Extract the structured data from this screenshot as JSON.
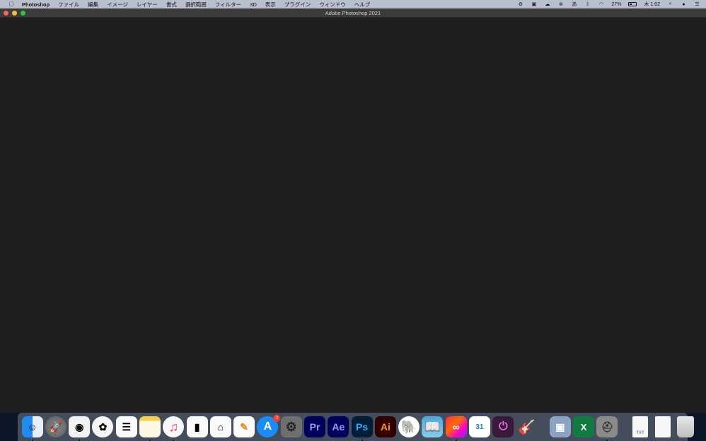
{
  "menubar": {
    "app_name": "Photoshop",
    "menus": [
      "ファイル",
      "編集",
      "イメージ",
      "レイヤー",
      "書式",
      "選択範囲",
      "フィルター",
      "3D",
      "表示",
      "プラグイン",
      "ウィンドウ",
      "ヘルプ"
    ],
    "status": {
      "battery_percent": "27%",
      "battery_level": 0.27,
      "clock": "木 1:02",
      "input_method": "あ"
    }
  },
  "window": {
    "title": "Adobe Photoshop 2021"
  },
  "dock": {
    "apps": [
      {
        "name": "Finder",
        "icon": "finder-icon",
        "glyph": "☺",
        "running": true
      },
      {
        "name": "Launchpad",
        "icon": "launchpad-icon",
        "glyph": "🚀",
        "running": false
      },
      {
        "name": "Google Chrome",
        "icon": "chrome-icon",
        "glyph": "◉",
        "running": true
      },
      {
        "name": "Photos",
        "icon": "photos-icon",
        "glyph": "✿",
        "running": false
      },
      {
        "name": "Reminders",
        "icon": "reminders-icon",
        "glyph": "☰",
        "running": false
      },
      {
        "name": "Notes",
        "icon": "notes-icon",
        "glyph": "",
        "running": true
      },
      {
        "name": "Music",
        "icon": "music-icon",
        "glyph": "♫",
        "running": true
      },
      {
        "name": "Numbers",
        "icon": "numbers-icon",
        "glyph": "▮",
        "running": false
      },
      {
        "name": "Keynote",
        "icon": "keynote-icon",
        "glyph": "⌂",
        "running": false
      },
      {
        "name": "Pages",
        "icon": "pages-icon",
        "glyph": "✎",
        "running": false
      },
      {
        "name": "App Store",
        "icon": "app-store-icon",
        "glyph": "A",
        "running": false,
        "badge": "2"
      },
      {
        "name": "System Preferences",
        "icon": "system-preferences-icon",
        "glyph": "⚙",
        "running": false
      },
      {
        "name": "Adobe Premiere Pro",
        "icon": "premiere-pro-icon",
        "glyph": "Pr",
        "running": false
      },
      {
        "name": "Adobe After Effects",
        "icon": "after-effects-icon",
        "glyph": "Ae",
        "running": false
      },
      {
        "name": "Adobe Photoshop",
        "icon": "photoshop-icon",
        "glyph": "Ps",
        "running": true
      },
      {
        "name": "Adobe Illustrator",
        "icon": "illustrator-icon",
        "glyph": "Ai",
        "running": false
      },
      {
        "name": "Evernote",
        "icon": "evernote-icon",
        "glyph": "🐘",
        "running": false
      },
      {
        "name": "Kindle",
        "icon": "kindle-icon",
        "glyph": "📖",
        "running": false
      },
      {
        "name": "Creative Cloud",
        "icon": "creative-cloud-icon",
        "glyph": "∞",
        "running": true
      },
      {
        "name": "Google Calendar",
        "icon": "calendar-icon",
        "glyph": "31",
        "running": false
      },
      {
        "name": "Power",
        "icon": "power-icon",
        "glyph": "⏻",
        "running": false
      },
      {
        "name": "GarageBand",
        "icon": "garageband-icon",
        "glyph": "🎸",
        "running": false
      }
    ],
    "utilities": [
      {
        "name": "Preview",
        "icon": "preview-icon",
        "glyph": "▣",
        "running": false
      },
      {
        "name": "Microsoft Excel",
        "icon": "excel-icon",
        "glyph": "X",
        "running": false
      },
      {
        "name": "Disk Utility",
        "icon": "disk-utility-icon",
        "glyph": "⛑",
        "running": true
      }
    ],
    "files": [
      {
        "name": "Text File",
        "icon": "text-file-icon",
        "glyph": "TXT"
      },
      {
        "name": "Document",
        "icon": "document-icon",
        "glyph": ""
      },
      {
        "name": "Trash",
        "icon": "trash-icon",
        "glyph": ""
      }
    ]
  }
}
